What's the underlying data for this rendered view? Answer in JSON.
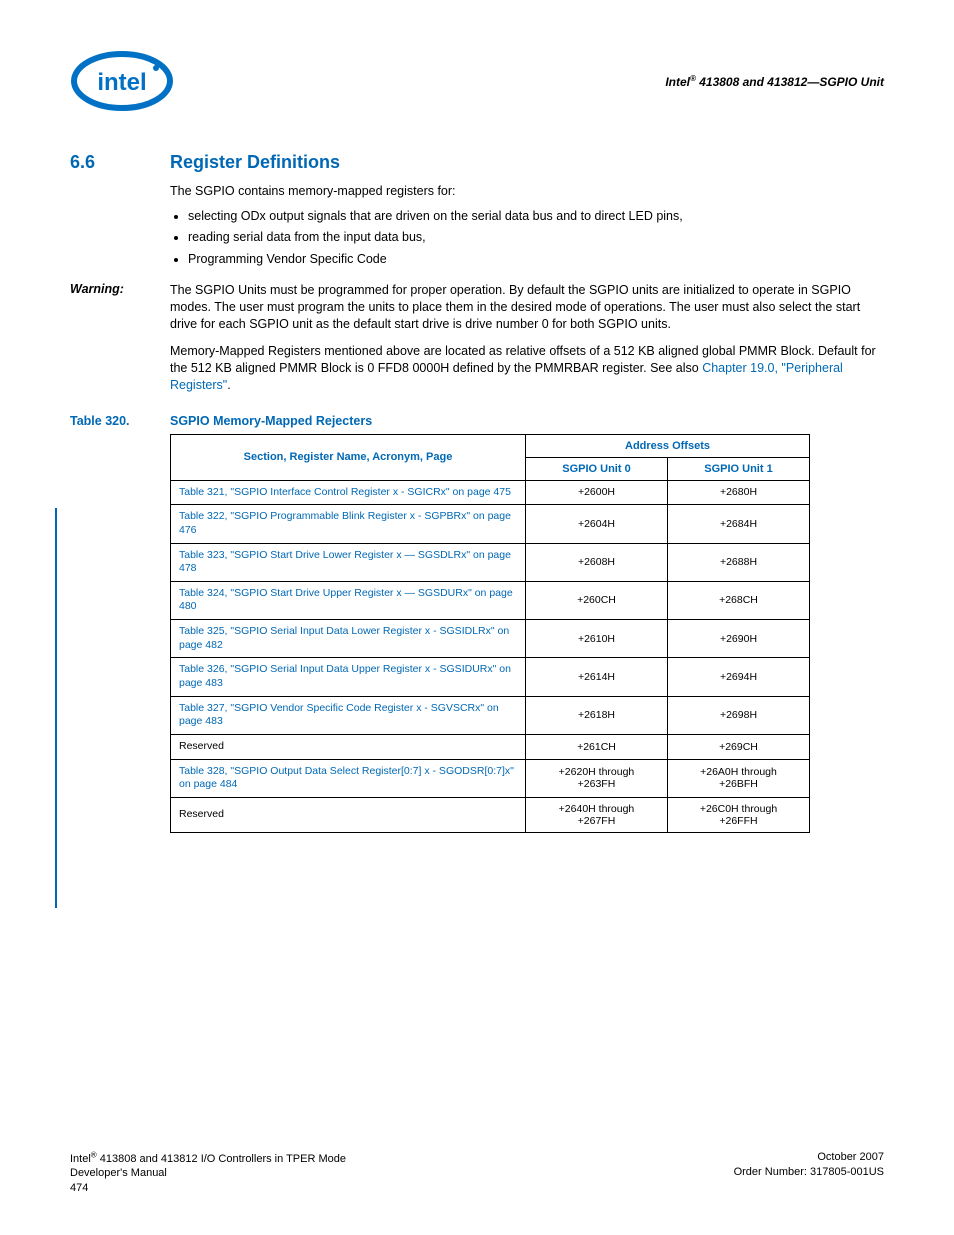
{
  "header": {
    "doc_title": "Intel® 413808 and 413812—SGPIO Unit"
  },
  "section": {
    "number": "6.6",
    "title": "Register Definitions",
    "intro": "The SGPIO contains memory-mapped registers for:",
    "bullets": [
      "selecting ODx output signals that are driven on the serial data bus and to direct LED pins,",
      "reading serial data from the input data bus,",
      "Programming Vendor Specific Code"
    ]
  },
  "warning": {
    "label": "Warning:",
    "text": "The SGPIO Units must be programmed for proper operation. By default the SGPIO units are initialized to operate in SGPIO modes. The user must program the units to place them in the desired mode of operations. The user must also select the start drive for each SGPIO unit as the default start drive is drive number 0 for both SGPIO units."
  },
  "para2": {
    "pre": "Memory-Mapped Registers mentioned above are located as relative offsets of a 512 KB aligned global PMMR Block. Default for the 512 KB aligned PMMR Block is 0 FFD8 0000H defined by the PMMRBAR register. See also ",
    "link": "Chapter 19.0, \"Peripheral Registers\"",
    "post": "."
  },
  "table": {
    "number": "Table 320.",
    "title": "SGPIO Memory-Mapped Rejecters",
    "head_name": "Section, Register Name, Acronym, Page",
    "head_offsets": "Address Offsets",
    "head_u0": "SGPIO Unit 0",
    "head_u1": "SGPIO Unit 1",
    "rows": [
      {
        "name": "Table 321, \"SGPIO Interface Control Register x - SGICRx\" on page 475",
        "u0": "+2600H",
        "u1": "+2680H",
        "link": true
      },
      {
        "name": "Table 322, \"SGPIO Programmable Blink Register x - SGPBRx\" on page 476",
        "u0": "+2604H",
        "u1": "+2684H",
        "link": true
      },
      {
        "name": "Table 323, \"SGPIO Start Drive Lower Register x — SGSDLRx\" on page 478",
        "u0": "+2608H",
        "u1": "+2688H",
        "link": true
      },
      {
        "name": "Table 324, \"SGPIO Start Drive Upper Register x — SGSDURx\" on page 480",
        "u0": "+260CH",
        "u1": "+268CH",
        "link": true
      },
      {
        "name": "Table 325, \"SGPIO Serial Input Data Lower Register x - SGSIDLRx\" on page 482",
        "u0": "+2610H",
        "u1": "+2690H",
        "link": true
      },
      {
        "name": "Table 326, \"SGPIO Serial Input Data Upper Register x - SGSIDURx\" on page 483",
        "u0": "+2614H",
        "u1": "+2694H",
        "link": true
      },
      {
        "name": "Table 327, \"SGPIO Vendor Specific Code Register x - SGVSCRx\" on page 483",
        "u0": "+2618H",
        "u1": "+2698H",
        "link": true
      },
      {
        "name": "Reserved",
        "u0": "+261CH",
        "u1": "+269CH",
        "link": false
      },
      {
        "name": "Table 328, \"SGPIO Output Data Select Register[0:7] x - SGODSR[0:7]x\" on page 484",
        "u0": "+2620H through\n+263FH",
        "u1": "+26A0H through\n+26BFH",
        "link": true
      },
      {
        "name": "Reserved",
        "u0": "+2640H through\n+267FH",
        "u1": "+26C0H through\n+26FFH",
        "link": false
      }
    ]
  },
  "footer": {
    "left1": "Intel® 413808 and 413812 I/O Controllers in TPER Mode",
    "left2": "Developer's Manual",
    "left3": "474",
    "right1": "October 2007",
    "right2": "Order Number: 317805-001US"
  }
}
